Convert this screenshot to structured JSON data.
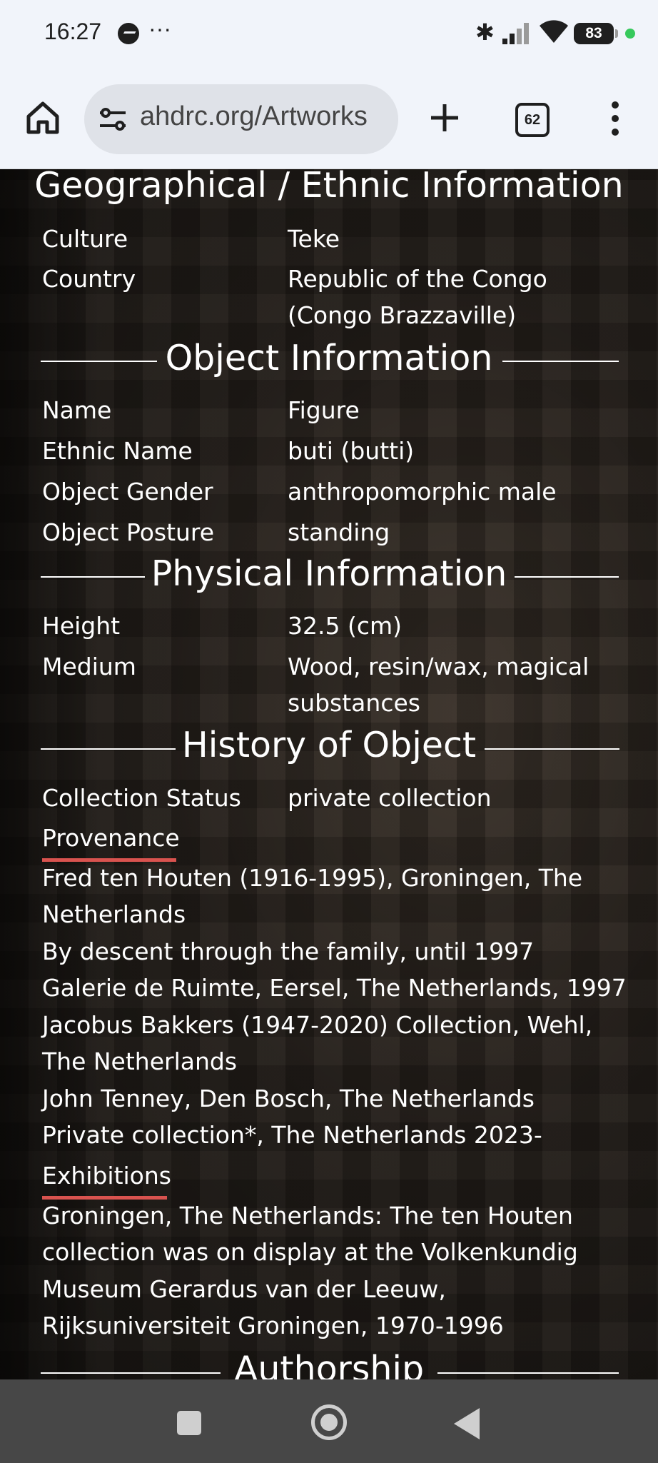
{
  "status_bar": {
    "time": "16:27",
    "more": "···",
    "battery": "83"
  },
  "browser": {
    "url": "ahdrc.org/Artworks",
    "tab_count": "62"
  },
  "geo": {
    "title": "Geographical / Ethnic Information",
    "culture_label": "Culture",
    "culture_value": "Teke",
    "country_label": "Country",
    "country_value_1": "Republic of the Congo",
    "country_value_2": "(Congo Brazzaville)"
  },
  "object": {
    "title": "Object Information",
    "name_label": "Name",
    "name_value": "Figure",
    "ethnic_label": "Ethnic Name",
    "ethnic_value": "buti (butti)",
    "gender_label": "Object Gender",
    "gender_value": "anthropomorphic male",
    "posture_label": "Object Posture",
    "posture_value": "standing"
  },
  "physical": {
    "title": "Physical Information",
    "height_label": "Height",
    "height_value": "32.5 (cm)",
    "medium_label": "Medium",
    "medium_value_1": "Wood, resin/wax, magical",
    "medium_value_2": "substances"
  },
  "history": {
    "title": "History of Object",
    "status_label": "Collection Status",
    "status_value": "private collection",
    "provenance_label": "Provenance",
    "provenance_lines": [
      "Fred ten Houten (1916-1995), Groningen, The",
      "Netherlands",
      "By descent through the family, until 1997",
      "Galerie de Ruimte, Eersel, The Netherlands, 1997",
      "Jacobus Bakkers (1947-2020) Collection, Wehl,",
      "The Netherlands",
      "John Tenney, Den Bosch, The Netherlands",
      "Private collection*, The Netherlands 2023-"
    ],
    "exhibitions_label": "Exhibitions",
    "exhibition_lines": [
      "Groningen, The Netherlands: The ten Houten",
      "collection was on display at the Volkenkundig",
      "Museum Gerardus van der Leeuw,",
      "Rijksuniversiteit Groningen, 1970-1996"
    ]
  },
  "authorship": {
    "title": "Authorship"
  }
}
